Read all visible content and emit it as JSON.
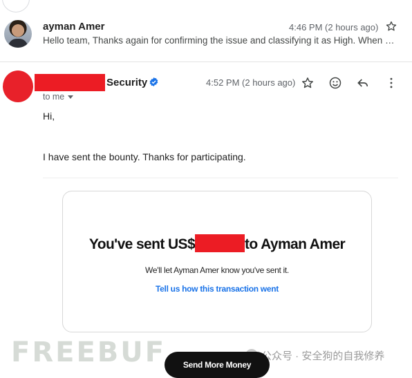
{
  "thread": {
    "message1": {
      "sender": "ayman Amer",
      "time": "4:46 PM (2 hours ago)",
      "snippet": "Hello team, Thanks again for confirming the issue and classifying it as High. When I joined the program"
    },
    "message2": {
      "sender_suffix": "Security",
      "time": "4:52 PM (2 hours ago)",
      "to": "to me",
      "greeting": "Hi,",
      "body": "I have sent the bounty. Thanks for participating."
    }
  },
  "payment_card": {
    "headline_before": "You've sent US$",
    "headline_after": "to Ayman Amer",
    "subtext": "We'll let Ayman Amer know you've sent it.",
    "link": "Tell us how this transaction went",
    "button": "Send More Money"
  },
  "watermark": {
    "logo": "FREEBUF",
    "text": "公众号 · 安全狗的自我修养"
  },
  "colors": {
    "redaction": "#ec1c24",
    "link": "#1a73e8",
    "verified": "#1a73e8"
  },
  "icons": [
    "star-icon",
    "verified-badge-icon",
    "emoji-icon",
    "reply-icon",
    "more-vert-icon",
    "chevron-down-icon"
  ]
}
